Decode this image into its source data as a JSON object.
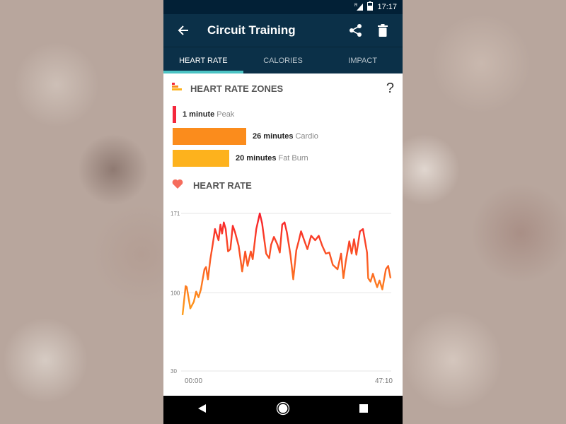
{
  "status": {
    "time": "17:17",
    "signal_label": "R"
  },
  "appbar": {
    "title": "Circuit Training",
    "icons": [
      "back-arrow-icon",
      "share-icon",
      "trash-icon"
    ]
  },
  "tabs": [
    {
      "label": "HEART RATE",
      "active": true
    },
    {
      "label": "CALORIES",
      "active": false
    },
    {
      "label": "IMPACT",
      "active": false
    }
  ],
  "zones": {
    "title": "HEART RATE ZONES",
    "help": "?",
    "items": [
      {
        "minutes": 1,
        "duration": "1 minute",
        "name": "Peak",
        "color": "#f4283c"
      },
      {
        "minutes": 26,
        "duration": "26 minutes",
        "name": "Cardio",
        "color": "#fb8c1c"
      },
      {
        "minutes": 20,
        "duration": "20 minutes",
        "name": "Fat Burn",
        "color": "#fdb21d"
      }
    ]
  },
  "heart_rate": {
    "title": "HEART RATE"
  },
  "chart_data": {
    "type": "line",
    "yticks": [
      "171",
      "100",
      "30"
    ],
    "ylim": [
      30,
      171
    ],
    "xticks": [
      "00:00",
      "47:10"
    ],
    "xlim": [
      "00:00",
      "47:10"
    ],
    "grid": true,
    "colors": {
      "low": "#ffa31a",
      "high": "#f81e2c"
    },
    "x": [
      "00:00",
      "00:42",
      "00:58",
      "01:46",
      "02:34",
      "03:06",
      "03:38",
      "04:10",
      "04:26",
      "04:58",
      "05:20",
      "05:46",
      "06:18",
      "06:50",
      "07:22",
      "08:10",
      "08:36",
      "08:58",
      "09:21",
      "09:47",
      "10:19",
      "10:51",
      "11:23",
      "11:55",
      "12:43",
      "13:31",
      "14:13",
      "14:45",
      "15:29",
      "15:55",
      "16:43",
      "17:31",
      "18:03",
      "18:58",
      "19:39",
      "20:05",
      "20:44",
      "21:32",
      "22:04",
      "22:36",
      "23:08",
      "23:40",
      "24:28",
      "25:06",
      "25:48",
      "26:20",
      "26:52",
      "27:40",
      "28:19",
      "29:10",
      "30:05",
      "30:53",
      "31:41",
      "32:29",
      "33:17",
      "34:05",
      "35:09",
      "35:57",
      "36:29",
      "37:01",
      "37:49",
      "38:21",
      "38:53",
      "39:25",
      "40:14",
      "40:55",
      "41:50",
      "42:06",
      "42:38",
      "43:10",
      "43:42",
      "44:08",
      "44:40",
      "45:18",
      "46:06",
      "46:38",
      "47:10"
    ],
    "y": [
      80,
      106,
      105,
      86,
      92,
      101,
      96,
      103,
      109,
      121,
      123,
      112,
      130,
      143,
      157,
      147,
      161,
      153,
      163,
      157,
      137,
      139,
      160,
      154,
      142,
      119,
      137,
      124,
      137,
      130,
      157,
      171,
      162,
      135,
      131,
      143,
      150,
      143,
      136,
      161,
      163,
      154,
      134,
      112,
      138,
      146,
      155,
      146,
      139,
      151,
      147,
      151,
      142,
      135,
      136,
      125,
      121,
      135,
      113,
      128,
      146,
      135,
      148,
      134,
      155,
      157,
      136,
      113,
      110,
      117,
      110,
      105,
      111,
      103,
      121,
      124,
      113
    ]
  },
  "nav": {
    "icons": [
      "back-triangle-icon",
      "home-circle-icon",
      "recents-square-icon"
    ]
  }
}
